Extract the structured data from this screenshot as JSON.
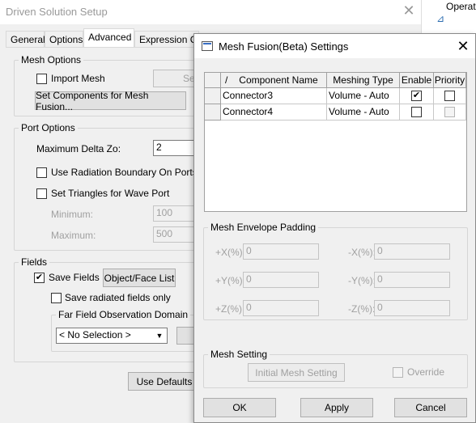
{
  "driven": {
    "title": "Driven Solution Setup",
    "close_glyph": "✕",
    "tabs": [
      "General",
      "Options",
      "Advanced",
      "Expression Ca"
    ],
    "mesh_options": {
      "title": "Mesh Options",
      "import_mesh": "Import Mesh",
      "partial_button": "Se",
      "set_components": "Set Components for Mesh Fusion..."
    },
    "port_options": {
      "title": "Port Options",
      "max_delta_zo_label": "Maximum Delta Zo:",
      "max_delta_zo_value": "2",
      "use_radiation": "Use Radiation Boundary On Ports",
      "set_triangles": "Set Triangles for Wave Port",
      "minimum_label": "Minimum:",
      "minimum_value": "100",
      "maximum_label": "Maximum:",
      "maximum_value": "500"
    },
    "fields": {
      "title": "Fields",
      "save_fields": "Save Fields",
      "object_face_list": "Object/Face List",
      "save_radiated": "Save radiated fields only",
      "far_field_title": "Far Field Observation Domain",
      "selection": "< No Selection >"
    },
    "use_defaults": "Use Defaults"
  },
  "strip": {
    "operations": "Operat"
  },
  "mesh_fusion": {
    "title": "Mesh Fusion(Beta) Settings",
    "close_glyph": "✕",
    "table": {
      "sort_glyph": "/",
      "headers": [
        "Component Name",
        "Meshing Type",
        "Enable",
        "Priority"
      ],
      "rows": [
        {
          "name": "Connector3",
          "meshing": "Volume - Auto",
          "enable": true,
          "priority": false
        },
        {
          "name": "Connector4",
          "meshing": "Volume - Auto",
          "enable": false,
          "priority": false
        }
      ]
    },
    "padding": {
      "title": "Mesh Envelope Padding",
      "plus_x_label": "+X(%):",
      "plus_x_value": "0",
      "minus_x_label": "-X(%):",
      "minus_x_value": "0",
      "plus_y_label": "+Y(%):",
      "plus_y_value": "0",
      "minus_y_label": "-Y(%):",
      "minus_y_value": "0",
      "plus_z_label": "+Z(%):",
      "plus_z_value": "0",
      "minus_z_label": "-Z(%):",
      "minus_z_value": "0"
    },
    "mesh_setting": {
      "title": "Mesh Setting",
      "initial_button": "Initial Mesh Setting",
      "override": "Override"
    },
    "ok": "OK",
    "apply": "Apply",
    "cancel": "Cancel"
  }
}
